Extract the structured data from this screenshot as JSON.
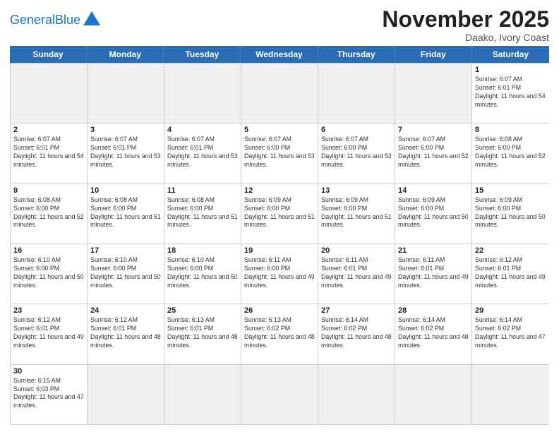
{
  "header": {
    "logo_general": "General",
    "logo_blue": "Blue",
    "month_title": "November 2025",
    "location": "Daako, Ivory Coast"
  },
  "weekdays": [
    "Sunday",
    "Monday",
    "Tuesday",
    "Wednesday",
    "Thursday",
    "Friday",
    "Saturday"
  ],
  "rows": [
    [
      {
        "day": "",
        "empty": true
      },
      {
        "day": "",
        "empty": true
      },
      {
        "day": "",
        "empty": true
      },
      {
        "day": "",
        "empty": true
      },
      {
        "day": "",
        "empty": true
      },
      {
        "day": "",
        "empty": true
      },
      {
        "day": "1",
        "sunrise": "Sunrise: 6:07 AM",
        "sunset": "Sunset: 6:01 PM",
        "daylight": "Daylight: 11 hours and 54 minutes."
      }
    ],
    [
      {
        "day": "2",
        "sunrise": "Sunrise: 6:07 AM",
        "sunset": "Sunset: 6:01 PM",
        "daylight": "Daylight: 11 hours and 54 minutes."
      },
      {
        "day": "3",
        "sunrise": "Sunrise: 6:07 AM",
        "sunset": "Sunset: 6:01 PM",
        "daylight": "Daylight: 11 hours and 53 minutes."
      },
      {
        "day": "4",
        "sunrise": "Sunrise: 6:07 AM",
        "sunset": "Sunset: 6:01 PM",
        "daylight": "Daylight: 11 hours and 53 minutes."
      },
      {
        "day": "5",
        "sunrise": "Sunrise: 6:07 AM",
        "sunset": "Sunset: 6:00 PM",
        "daylight": "Daylight: 11 hours and 53 minutes."
      },
      {
        "day": "6",
        "sunrise": "Sunrise: 6:07 AM",
        "sunset": "Sunset: 6:00 PM",
        "daylight": "Daylight: 11 hours and 52 minutes."
      },
      {
        "day": "7",
        "sunrise": "Sunrise: 6:07 AM",
        "sunset": "Sunset: 6:00 PM",
        "daylight": "Daylight: 11 hours and 52 minutes."
      },
      {
        "day": "8",
        "sunrise": "Sunrise: 6:08 AM",
        "sunset": "Sunset: 6:00 PM",
        "daylight": "Daylight: 11 hours and 52 minutes."
      }
    ],
    [
      {
        "day": "9",
        "sunrise": "Sunrise: 6:08 AM",
        "sunset": "Sunset: 6:00 PM",
        "daylight": "Daylight: 11 hours and 52 minutes."
      },
      {
        "day": "10",
        "sunrise": "Sunrise: 6:08 AM",
        "sunset": "Sunset: 6:00 PM",
        "daylight": "Daylight: 11 hours and 51 minutes."
      },
      {
        "day": "11",
        "sunrise": "Sunrise: 6:08 AM",
        "sunset": "Sunset: 6:00 PM",
        "daylight": "Daylight: 11 hours and 51 minutes."
      },
      {
        "day": "12",
        "sunrise": "Sunrise: 6:09 AM",
        "sunset": "Sunset: 6:00 PM",
        "daylight": "Daylight: 11 hours and 51 minutes."
      },
      {
        "day": "13",
        "sunrise": "Sunrise: 6:09 AM",
        "sunset": "Sunset: 6:00 PM",
        "daylight": "Daylight: 11 hours and 51 minutes."
      },
      {
        "day": "14",
        "sunrise": "Sunrise: 6:09 AM",
        "sunset": "Sunset: 6:00 PM",
        "daylight": "Daylight: 11 hours and 50 minutes."
      },
      {
        "day": "15",
        "sunrise": "Sunrise: 6:09 AM",
        "sunset": "Sunset: 6:00 PM",
        "daylight": "Daylight: 11 hours and 50 minutes."
      }
    ],
    [
      {
        "day": "16",
        "sunrise": "Sunrise: 6:10 AM",
        "sunset": "Sunset: 6:00 PM",
        "daylight": "Daylight: 11 hours and 50 minutes."
      },
      {
        "day": "17",
        "sunrise": "Sunrise: 6:10 AM",
        "sunset": "Sunset: 6:00 PM",
        "daylight": "Daylight: 11 hours and 50 minutes."
      },
      {
        "day": "18",
        "sunrise": "Sunrise: 6:10 AM",
        "sunset": "Sunset: 6:00 PM",
        "daylight": "Daylight: 11 hours and 50 minutes."
      },
      {
        "day": "19",
        "sunrise": "Sunrise: 6:11 AM",
        "sunset": "Sunset: 6:00 PM",
        "daylight": "Daylight: 11 hours and 49 minutes."
      },
      {
        "day": "20",
        "sunrise": "Sunrise: 6:11 AM",
        "sunset": "Sunset: 6:01 PM",
        "daylight": "Daylight: 11 hours and 49 minutes."
      },
      {
        "day": "21",
        "sunrise": "Sunrise: 6:11 AM",
        "sunset": "Sunset: 6:01 PM",
        "daylight": "Daylight: 11 hours and 49 minutes."
      },
      {
        "day": "22",
        "sunrise": "Sunrise: 6:12 AM",
        "sunset": "Sunset: 6:01 PM",
        "daylight": "Daylight: 11 hours and 49 minutes."
      }
    ],
    [
      {
        "day": "23",
        "sunrise": "Sunrise: 6:12 AM",
        "sunset": "Sunset: 6:01 PM",
        "daylight": "Daylight: 11 hours and 49 minutes."
      },
      {
        "day": "24",
        "sunrise": "Sunrise: 6:12 AM",
        "sunset": "Sunset: 6:01 PM",
        "daylight": "Daylight: 11 hours and 48 minutes."
      },
      {
        "day": "25",
        "sunrise": "Sunrise: 6:13 AM",
        "sunset": "Sunset: 6:01 PM",
        "daylight": "Daylight: 11 hours and 48 minutes."
      },
      {
        "day": "26",
        "sunrise": "Sunrise: 6:13 AM",
        "sunset": "Sunset: 6:02 PM",
        "daylight": "Daylight: 11 hours and 48 minutes."
      },
      {
        "day": "27",
        "sunrise": "Sunrise: 6:14 AM",
        "sunset": "Sunset: 6:02 PM",
        "daylight": "Daylight: 11 hours and 48 minutes."
      },
      {
        "day": "28",
        "sunrise": "Sunrise: 6:14 AM",
        "sunset": "Sunset: 6:02 PM",
        "daylight": "Daylight: 11 hours and 48 minutes."
      },
      {
        "day": "29",
        "sunrise": "Sunrise: 6:14 AM",
        "sunset": "Sunset: 6:02 PM",
        "daylight": "Daylight: 11 hours and 47 minutes."
      }
    ],
    [
      {
        "day": "30",
        "sunrise": "Sunrise: 6:15 AM",
        "sunset": "Sunset: 6:03 PM",
        "daylight": "Daylight: 11 hours and 47 minutes."
      },
      {
        "day": "",
        "empty": true
      },
      {
        "day": "",
        "empty": true
      },
      {
        "day": "",
        "empty": true
      },
      {
        "day": "",
        "empty": true
      },
      {
        "day": "",
        "empty": true
      },
      {
        "day": "",
        "empty": true
      }
    ]
  ]
}
